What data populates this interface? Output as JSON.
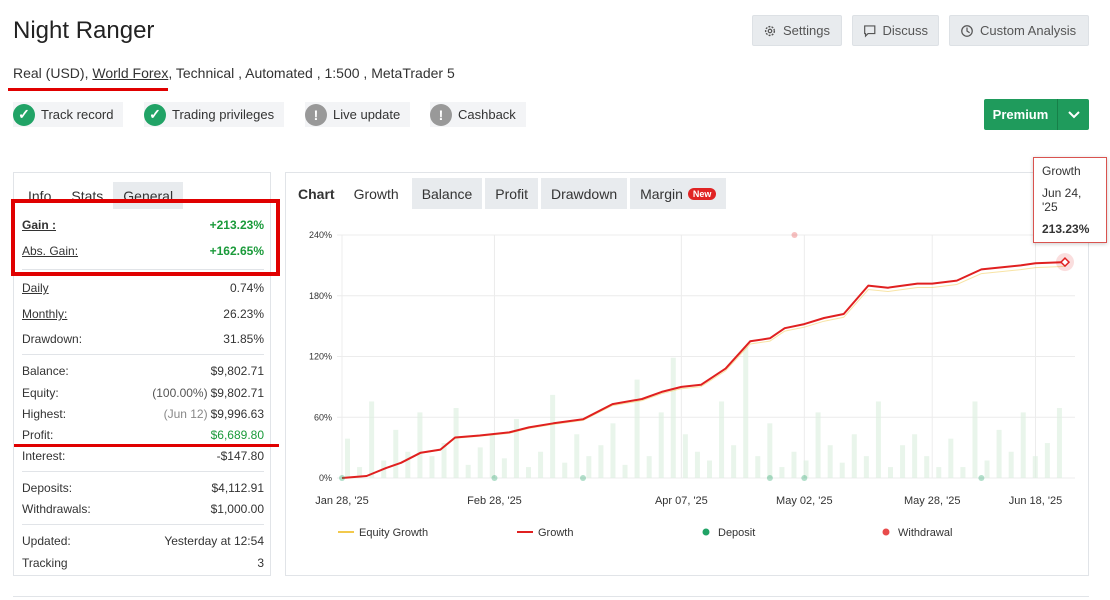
{
  "header": {
    "title": "Night Ranger",
    "account_type": "Real (USD)",
    "broker": "World Forex",
    "details": ", Technical , Automated , 1:500 , MetaTrader 5"
  },
  "buttons": {
    "settings": "Settings",
    "discuss": "Discuss",
    "custom_analysis": "Custom Analysis",
    "premium": "Premium"
  },
  "badges": [
    {
      "label": "Track record",
      "status": "verified"
    },
    {
      "label": "Trading privileges",
      "status": "verified"
    },
    {
      "label": "Live update",
      "status": "warning"
    },
    {
      "label": "Cashback",
      "status": "warning"
    }
  ],
  "left_tabs": [
    "Info",
    "Stats",
    "General"
  ],
  "stats": {
    "gain_label": "Gain :",
    "gain": "+213.23%",
    "abs_gain_label": "Abs. Gain:",
    "abs_gain": "+162.65%",
    "daily_label": "Daily",
    "daily": "0.74%",
    "monthly_label": "Monthly:",
    "monthly": "26.23%",
    "drawdown_label": "Drawdown:",
    "drawdown": "31.85%",
    "balance_label": "Balance:",
    "balance": "$9,802.71",
    "equity_label": "Equity:",
    "equity_pct": "(100.00%)",
    "equity": "$9,802.71",
    "highest_label": "Highest:",
    "highest_date": "(Jun 12)",
    "highest": "$9,996.63",
    "profit_label": "Profit:",
    "profit": "$6,689.80",
    "interest_label": "Interest:",
    "interest": "-$147.80",
    "deposits_label": "Deposits:",
    "deposits": "$4,112.91",
    "withdrawals_label": "Withdrawals:",
    "withdrawals": "$1,000.00",
    "updated_label": "Updated:",
    "updated": "Yesterday at 12:54",
    "tracking_label": "Tracking",
    "tracking": "3"
  },
  "chart_tabs": {
    "chart": "Chart",
    "growth": "Growth",
    "balance": "Balance",
    "profit": "Profit",
    "drawdown": "Drawdown",
    "margin": "Margin",
    "new_tag": "New"
  },
  "tooltip": {
    "series": "Growth",
    "date": "Jun 24, '25",
    "value": "213.23%"
  },
  "colors": {
    "growth": "#e02020",
    "equity": "#f2c94c",
    "deposit": "#21a366",
    "withdrawal": "#e84b4b",
    "premium": "#1f9b5c"
  },
  "chart_data": {
    "type": "line",
    "ylim": [
      0,
      240
    ],
    "y_ticks": [
      "0%",
      "60%",
      "120%",
      "180%",
      "240%"
    ],
    "x_ticks": [
      "Jan 28, '25",
      "Feb 28, '25",
      "Apr 07, '25",
      "May 02, '25",
      "May 28, '25",
      "Jun 18, '25"
    ],
    "legend": [
      "Equity Growth",
      "Growth",
      "Deposit",
      "Withdrawal"
    ],
    "series": [
      {
        "name": "Growth",
        "x": [
          "Jan 28, '25",
          "Feb 02, '25",
          "Feb 06, '25",
          "Feb 09, '25",
          "Feb 13, '25",
          "Feb 17, '25",
          "Feb 20, '25",
          "Feb 25, '25",
          "Mar 03, '25",
          "Mar 07, '25",
          "Mar 12, '25",
          "Mar 18, '25",
          "Mar 24, '25",
          "Mar 30, '25",
          "Apr 03, '25",
          "Apr 07, '25",
          "Apr 11, '25",
          "Apr 16, '25",
          "Apr 21, '25",
          "Apr 25, '25",
          "Apr 28, '25",
          "May 02, '25",
          "May 06, '25",
          "May 10, '25",
          "May 15, '25",
          "May 19, '25",
          "May 22, '25",
          "May 25, '25",
          "May 28, '25",
          "Jun 02, '25",
          "Jun 07, '25",
          "Jun 11, '25",
          "Jun 15, '25",
          "Jun 18, '25",
          "Jun 24, '25"
        ],
        "values": [
          0,
          2,
          10,
          15,
          25,
          28,
          40,
          42,
          45,
          50,
          54,
          58,
          73,
          78,
          85,
          90,
          92,
          108,
          135,
          138,
          148,
          152,
          158,
          162,
          190,
          188,
          190,
          192,
          192,
          195,
          206,
          208,
          210,
          212,
          213.23
        ]
      }
    ]
  }
}
